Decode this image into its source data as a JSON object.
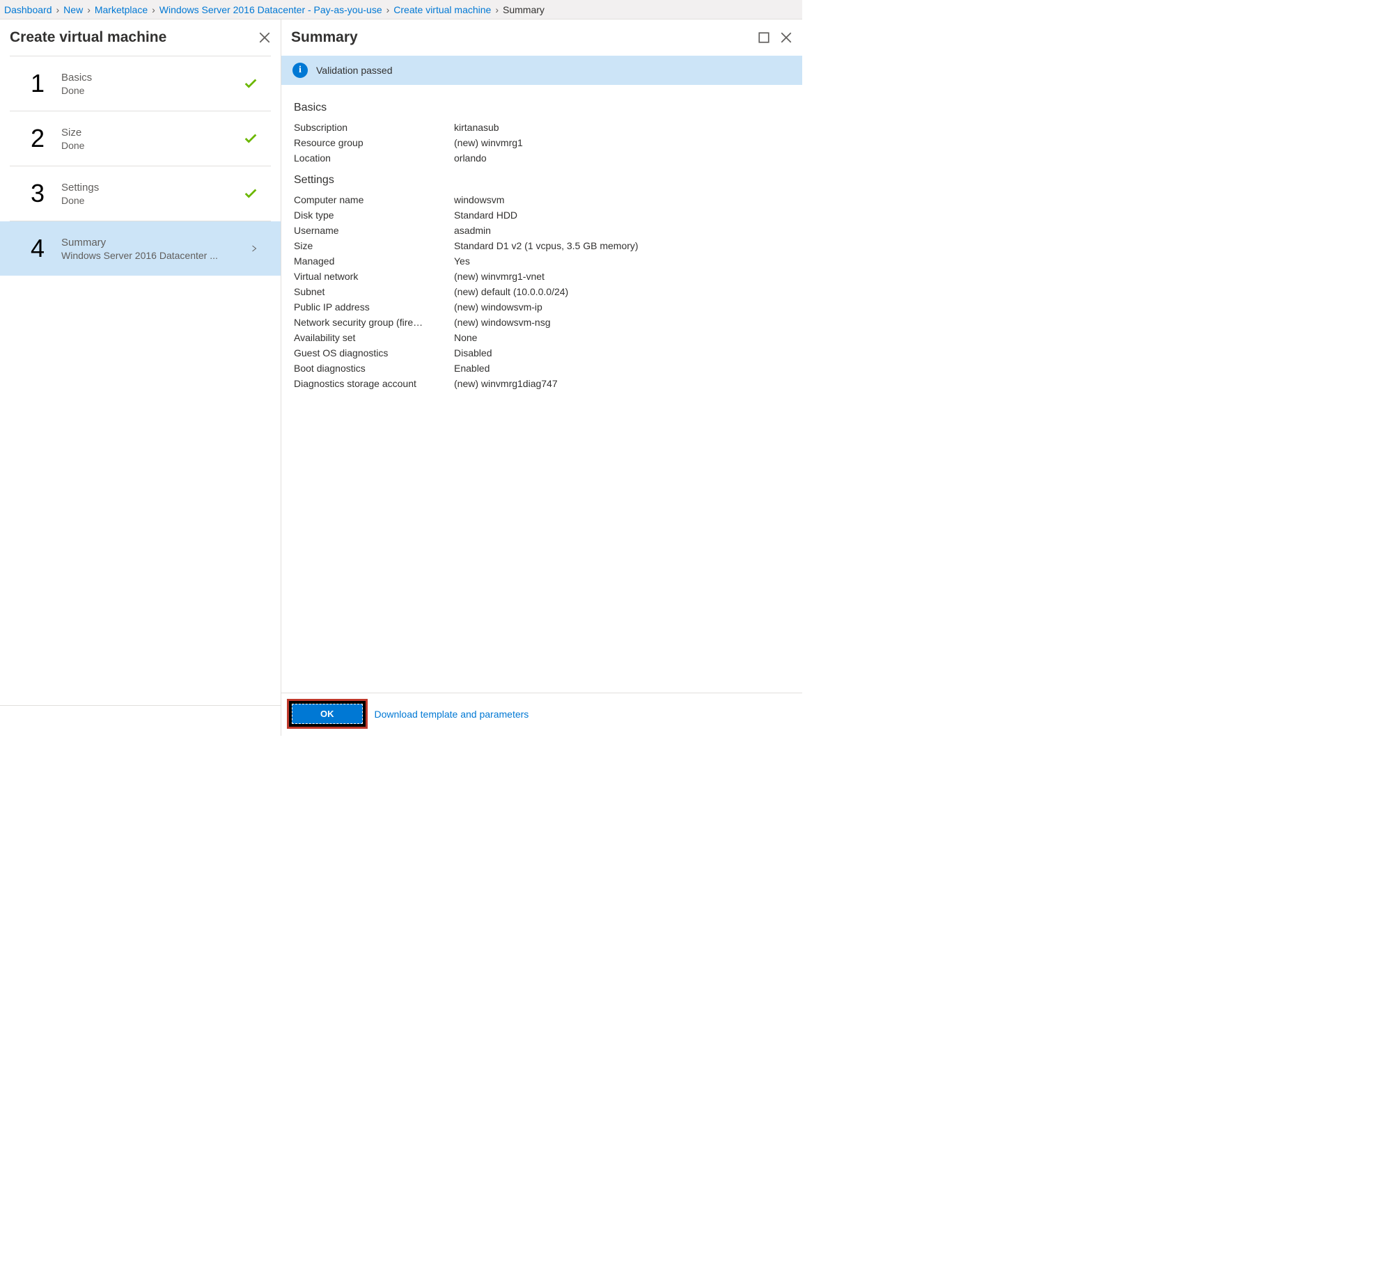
{
  "breadcrumb": {
    "items": [
      "Dashboard",
      "New",
      "Marketplace",
      "Windows Server 2016 Datacenter - Pay-as-you-use",
      "Create virtual machine"
    ],
    "current": "Summary"
  },
  "leftPanel": {
    "title": "Create virtual machine",
    "steps": [
      {
        "num": "1",
        "title": "Basics",
        "sub": "Done",
        "state": "done"
      },
      {
        "num": "2",
        "title": "Size",
        "sub": "Done",
        "state": "done"
      },
      {
        "num": "3",
        "title": "Settings",
        "sub": "Done",
        "state": "done"
      },
      {
        "num": "4",
        "title": "Summary",
        "sub": "Windows Server 2016 Datacenter ...",
        "state": "active"
      }
    ]
  },
  "rightPanel": {
    "title": "Summary",
    "validation": "Validation passed",
    "sections": {
      "basics": {
        "heading": "Basics",
        "rows": [
          {
            "k": "Subscription",
            "v": "kirtanasub"
          },
          {
            "k": "Resource group",
            "v": "(new) winvmrg1"
          },
          {
            "k": "Location",
            "v": "orlando"
          }
        ]
      },
      "settings": {
        "heading": "Settings",
        "rows": [
          {
            "k": "Computer name",
            "v": "windowsvm"
          },
          {
            "k": "Disk type",
            "v": "Standard HDD"
          },
          {
            "k": "Username",
            "v": "asadmin"
          },
          {
            "k": "Size",
            "v": "Standard D1 v2 (1 vcpus, 3.5 GB memory)"
          },
          {
            "k": "Managed",
            "v": "Yes"
          },
          {
            "k": "Virtual network",
            "v": "(new) winvmrg1-vnet"
          },
          {
            "k": "Subnet",
            "v": "(new) default (10.0.0.0/24)"
          },
          {
            "k": "Public IP address",
            "v": "(new) windowsvm-ip"
          },
          {
            "k": "Network security group (fire…",
            "v": "(new) windowsvm-nsg"
          },
          {
            "k": "Availability set",
            "v": "None"
          },
          {
            "k": "Guest OS diagnostics",
            "v": "Disabled"
          },
          {
            "k": "Boot diagnostics",
            "v": "Enabled"
          },
          {
            "k": "Diagnostics storage account",
            "v": "(new) winvmrg1diag747"
          }
        ]
      }
    },
    "footer": {
      "ok": "OK",
      "download": "Download template and parameters"
    }
  }
}
